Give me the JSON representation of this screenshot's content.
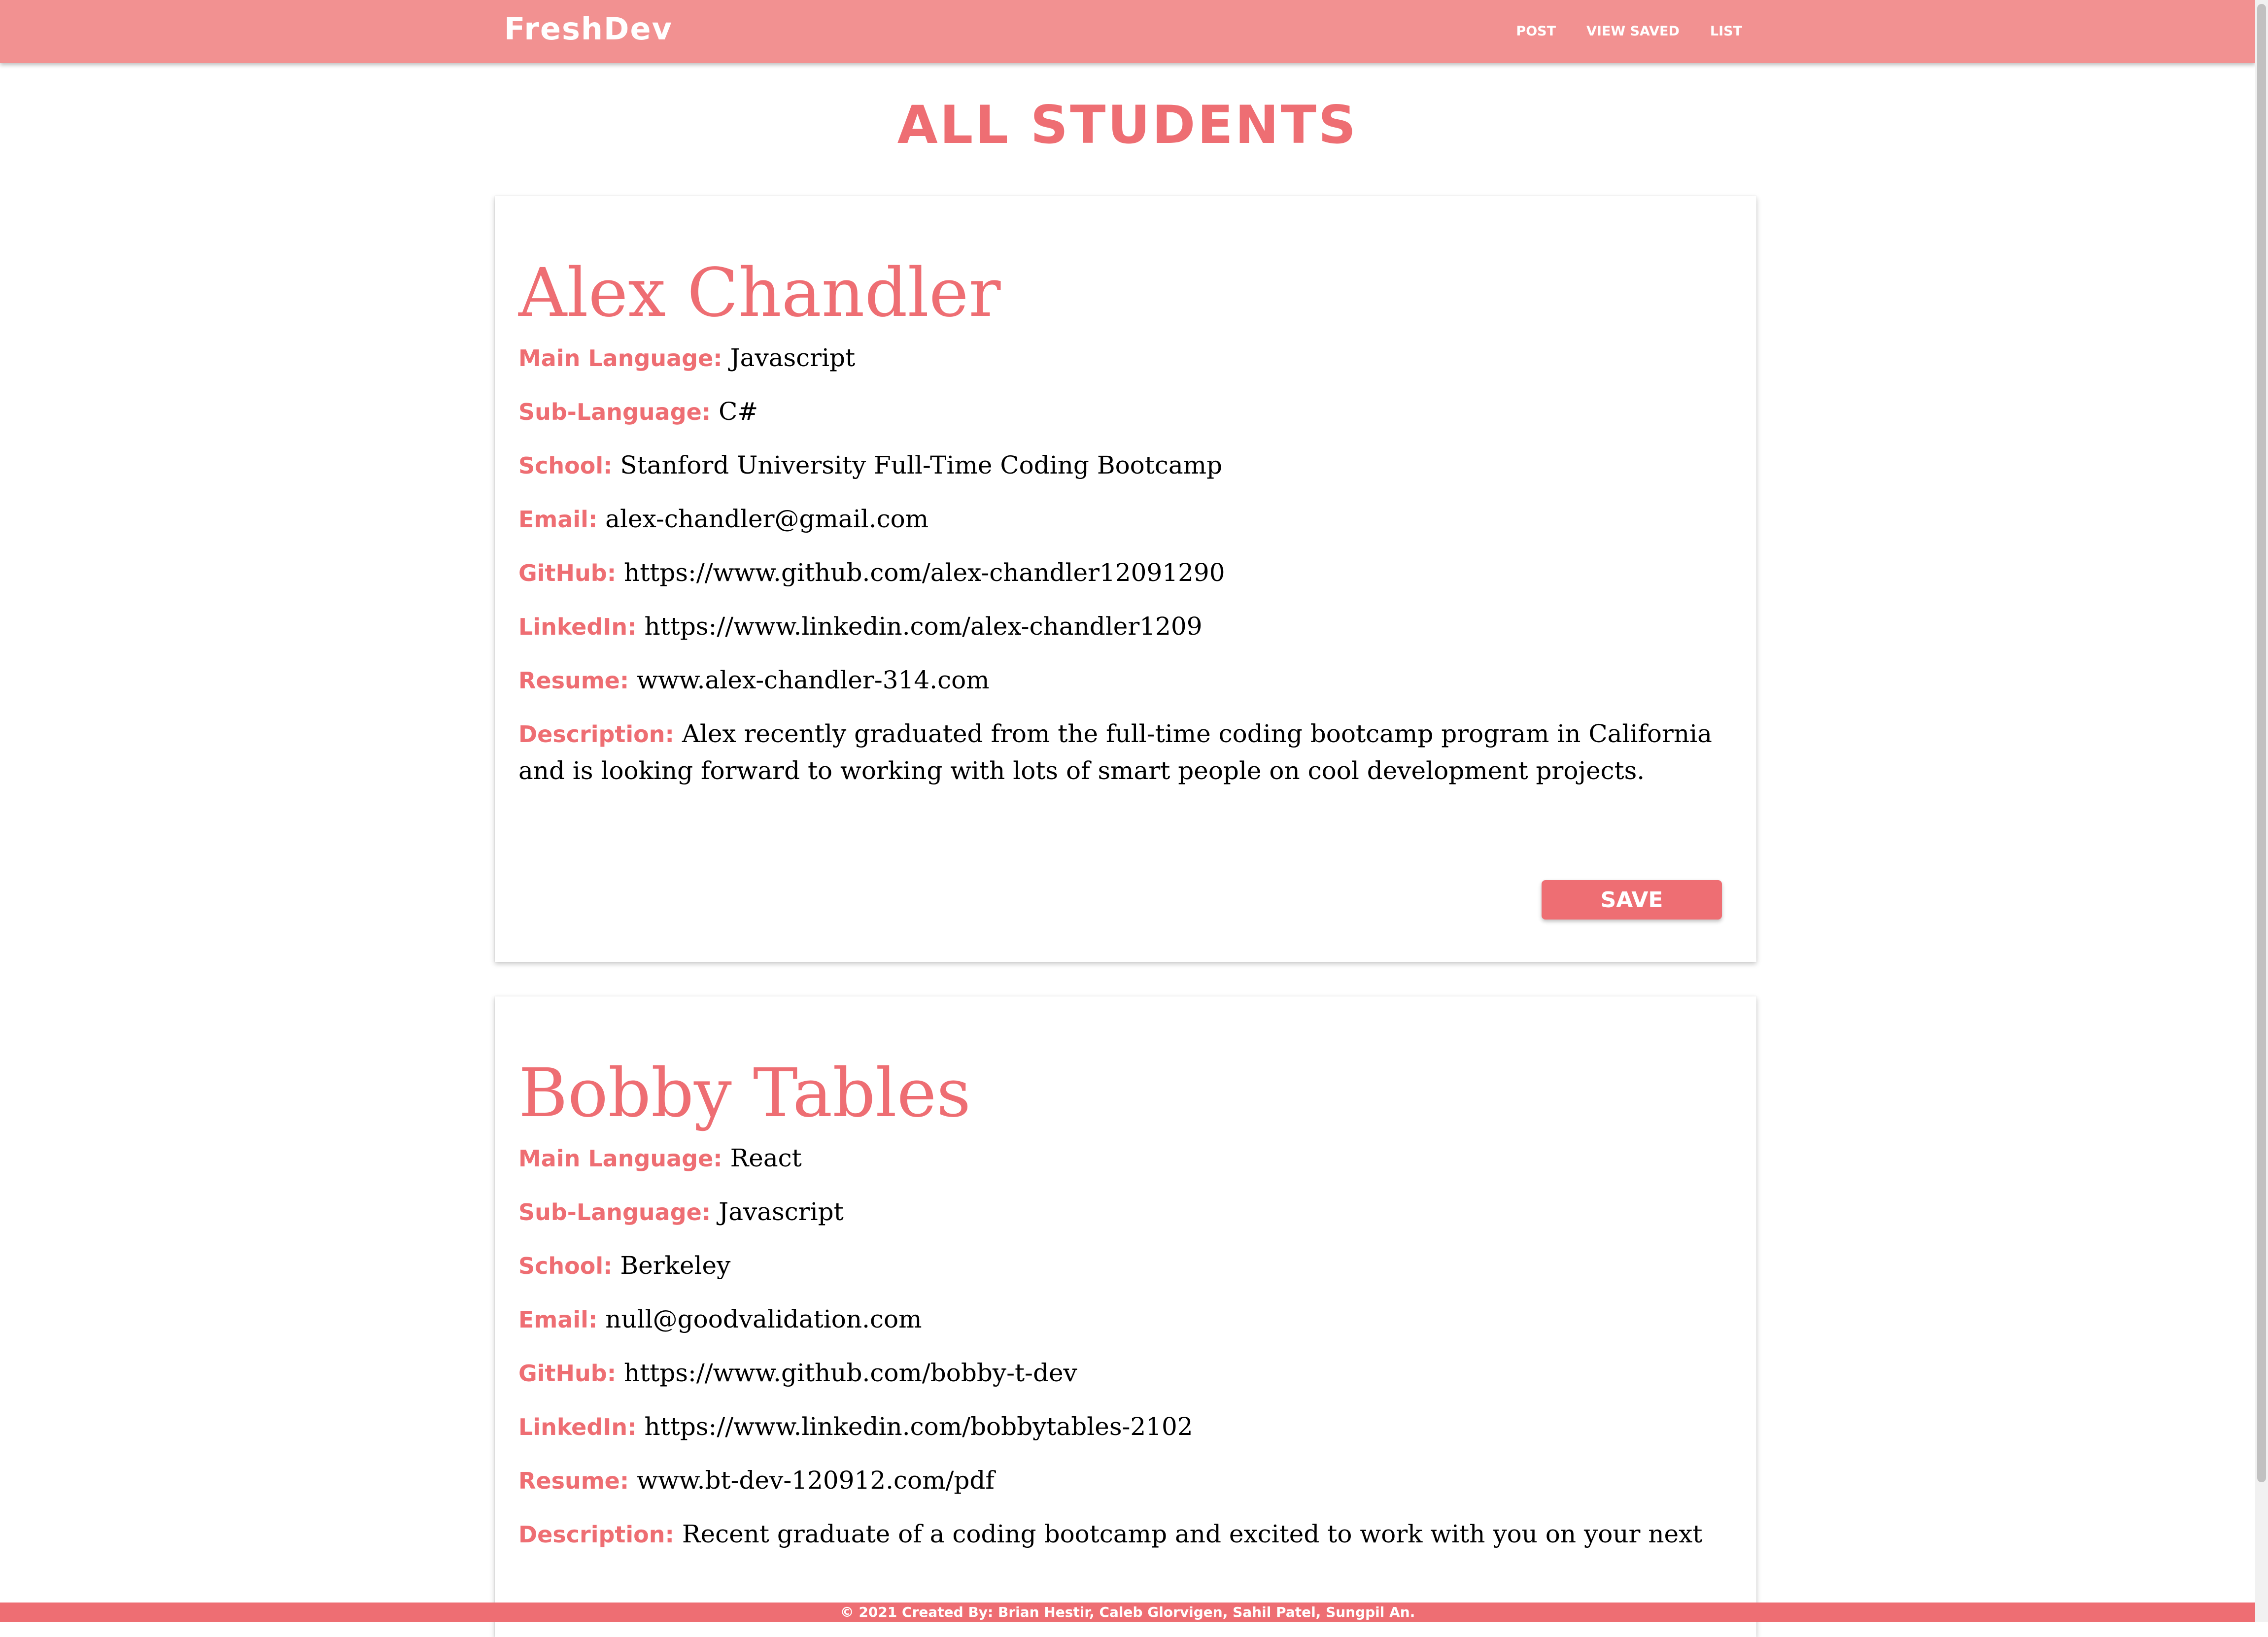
{
  "app": {
    "brand": "FreshDev"
  },
  "nav": {
    "items": [
      {
        "label": "Post"
      },
      {
        "label": "View Saved"
      },
      {
        "label": "List"
      }
    ]
  },
  "page": {
    "title": "All Students"
  },
  "labels": {
    "main_language": "Main Language:",
    "sub_language": "Sub-Language:",
    "school": "School:",
    "email": "Email:",
    "github": "GitHub:",
    "linkedin": "LinkedIn:",
    "resume": "Resume:",
    "description": "Description:",
    "save": "Save"
  },
  "students": [
    {
      "name": "Alex Chandler",
      "main_language": "Javascript",
      "sub_language": "C#",
      "school": "Stanford University Full-Time Coding Bootcamp",
      "email": "alex-chandler@gmail.com",
      "github": "https://www.github.com/alex-chandler12091290",
      "linkedin": "https://www.linkedin.com/alex-chandler1209",
      "resume": "www.alex-chandler-314.com",
      "description": "Alex recently graduated from the full-time coding bootcamp program in California and is looking forward to working with lots of smart people on cool development projects."
    },
    {
      "name": "Bobby Tables",
      "main_language": "React",
      "sub_language": "Javascript",
      "school": "Berkeley",
      "email": "null@goodvalidation.com",
      "github": "https://www.github.com/bobby-t-dev",
      "linkedin": "https://www.linkedin.com/bobbytables-2102",
      "resume": "www.bt-dev-120912.com/pdf",
      "description": "Recent graduate of a coding bootcamp and excited to work with you on your next"
    }
  ],
  "footer": {
    "text": "© 2021 Created By: Brian Hestir, Caleb Glorvigen, Sahil Patel, Sungpil An."
  },
  "colors": {
    "navbar": "#f29191",
    "accent": "#ee6e73"
  }
}
